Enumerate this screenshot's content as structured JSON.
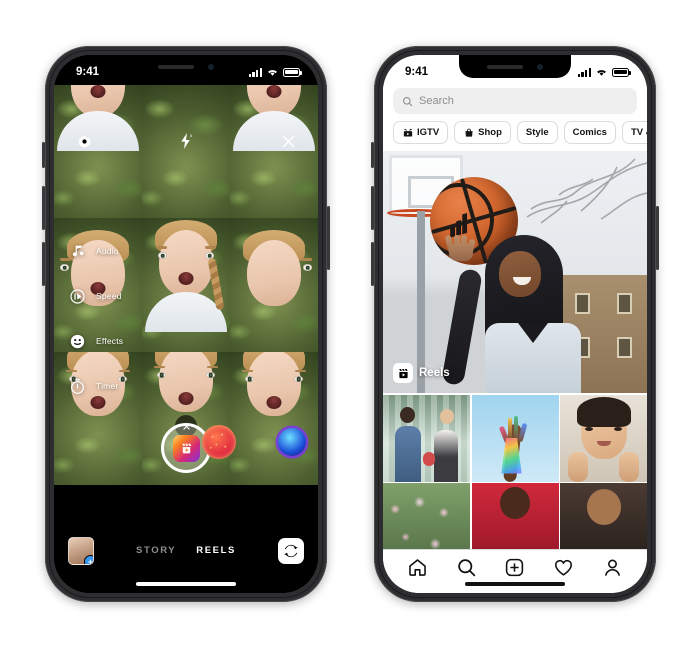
{
  "left_phone": {
    "status_bar": {
      "time": "9:41",
      "signal_icon": "cellular-bars-icon",
      "wifi_icon": "wifi-icon",
      "battery_icon": "battery-icon"
    },
    "camera": {
      "top_controls": [
        {
          "name": "settings-icon",
          "label": "Settings"
        },
        {
          "name": "flash-off-icon",
          "label": "Flash off"
        },
        {
          "name": "close-icon",
          "label": "Close"
        }
      ],
      "side_tools": [
        {
          "icon": "audio-icon",
          "label": "Audio"
        },
        {
          "icon": "speed-icon",
          "label": "Speed"
        },
        {
          "icon": "effects-icon",
          "label": "Effects"
        },
        {
          "icon": "timer-icon",
          "label": "Timer"
        }
      ],
      "clear_effect_label": "✕",
      "shutter": {
        "name": "reels-record-button",
        "glyph": "reels-icon"
      },
      "effect_thumbs": [
        {
          "name": "effect-thumb-sparkle",
          "color": "#e0243f"
        },
        {
          "name": "effect-thumb-blue",
          "color": "#1a4ed8"
        }
      ],
      "gallery": {
        "name": "gallery-thumb",
        "badge": "+"
      },
      "flip_camera_icon": "flip-camera-icon",
      "modes": [
        {
          "label": "STORY",
          "active": false
        },
        {
          "label": "REELS",
          "active": true
        }
      ]
    }
  },
  "right_phone": {
    "status_bar": {
      "time": "9:41",
      "signal_icon": "cellular-bars-icon",
      "wifi_icon": "wifi-icon",
      "battery_icon": "battery-icon"
    },
    "explore": {
      "search": {
        "placeholder": "Search",
        "value": "",
        "icon": "search-icon"
      },
      "categories": [
        {
          "label": "IGTV",
          "icon": "igtv-icon"
        },
        {
          "label": "Shop",
          "icon": "shopping-bag-icon"
        },
        {
          "label": "Style",
          "icon": ""
        },
        {
          "label": "Comics",
          "icon": ""
        },
        {
          "label": "TV & Movies",
          "icon": ""
        }
      ],
      "feature_card": {
        "badge_label": "Reels",
        "badge_icon": "reels-icon"
      },
      "grid_row_1": [
        {
          "name": "explore-thumb-couple"
        },
        {
          "name": "explore-thumb-glitter-hand"
        },
        {
          "name": "explore-thumb-portrait"
        }
      ],
      "grid_row_2": [
        {
          "name": "explore-thumb-flowers"
        },
        {
          "name": "explore-thumb-red-dress"
        },
        {
          "name": "explore-thumb-dark-portrait"
        }
      ],
      "bottom_nav": [
        {
          "name": "nav-home",
          "icon": "home-icon"
        },
        {
          "name": "nav-search",
          "icon": "search-icon"
        },
        {
          "name": "nav-add",
          "icon": "plus-square-icon"
        },
        {
          "name": "nav-activity",
          "icon": "heart-icon"
        },
        {
          "name": "nav-profile",
          "icon": "person-icon"
        }
      ]
    }
  }
}
